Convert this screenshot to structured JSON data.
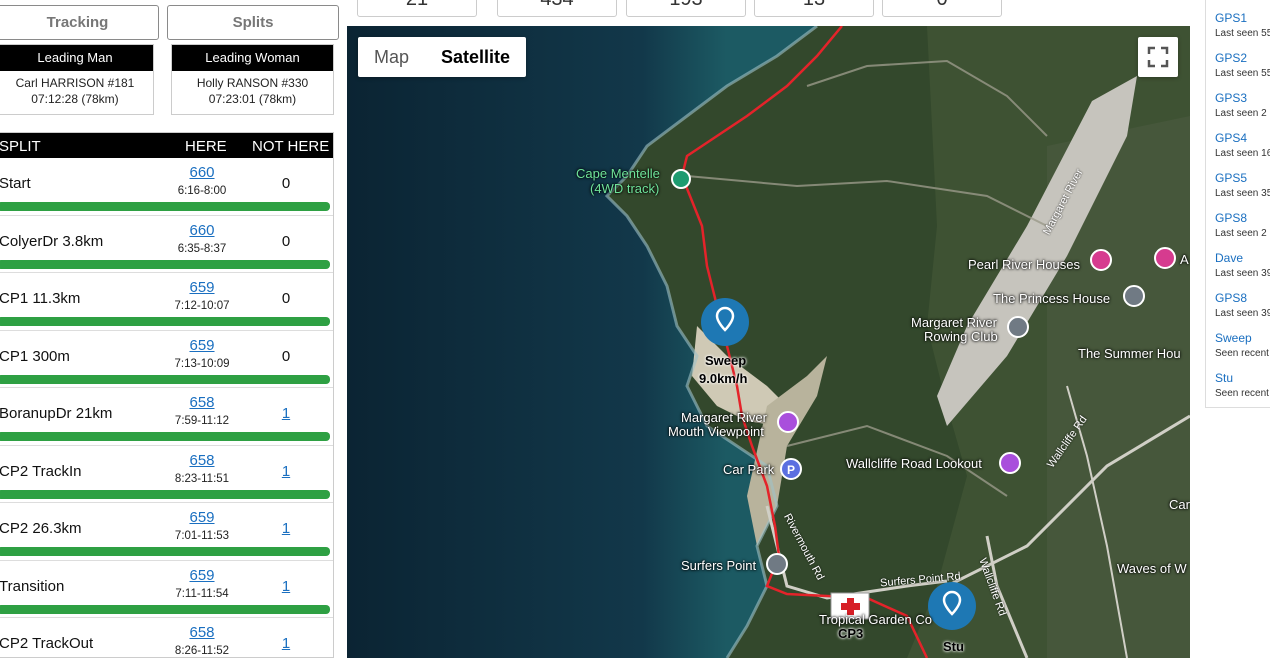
{
  "tabs": {
    "tracking": "Tracking",
    "splits": "Splits"
  },
  "leaders": {
    "man": {
      "title": "Leading Man",
      "name": "Carl HARRISON #181",
      "time": "07:12:28 (78km)"
    },
    "woman": {
      "title": "Leading Woman",
      "name": "Holly RANSON #330",
      "time": "07:23:01 (78km)"
    }
  },
  "stats": [
    "21",
    "434",
    "193",
    "13",
    "0"
  ],
  "splits": {
    "headers": {
      "split": "SPLIT",
      "here": "HERE",
      "not_here": "NOT HERE"
    },
    "rows": [
      {
        "name": "Start",
        "here": "660",
        "range": "6:16-8:00",
        "not_here": "0",
        "not_link": false
      },
      {
        "name": "ColyerDr 3.8km",
        "here": "660",
        "range": "6:35-8:37",
        "not_here": "0",
        "not_link": false
      },
      {
        "name": "CP1 11.3km",
        "here": "659",
        "range": "7:12-10:07",
        "not_here": "0",
        "not_link": false
      },
      {
        "name": "CP1 300m",
        "here": "659",
        "range": "7:13-10:09",
        "not_here": "0",
        "not_link": false
      },
      {
        "name": "BoranupDr 21km",
        "here": "658",
        "range": "7:59-11:12",
        "not_here": "1",
        "not_link": true
      },
      {
        "name": "CP2 TrackIn",
        "here": "658",
        "range": "8:23-11:51",
        "not_here": "1",
        "not_link": true
      },
      {
        "name": "CP2 26.3km",
        "here": "659",
        "range": "7:01-11:53",
        "not_here": "1",
        "not_link": true
      },
      {
        "name": "Transition",
        "here": "659",
        "range": "7:11-11:54",
        "not_here": "1",
        "not_link": true
      },
      {
        "name": "CP2 TrackOut",
        "here": "658",
        "range": "8:26-11:52",
        "not_here": "1",
        "not_link": true
      }
    ]
  },
  "map": {
    "map_label": "Map",
    "satellite_label": "Satellite",
    "labels": {
      "cape_mentelle": "Cape Mentelle",
      "cape_mentelle_sub": "(4WD track)",
      "sweep": "Sweep",
      "sweep_speed": "9.0km/h",
      "viewpoint1": "Margaret River",
      "viewpoint2": "Mouth Viewpoint",
      "car_park": "Car Park",
      "lookout": "Wallcliffe Road Lookout",
      "surfers_point": "Surfers Point",
      "garden": "Tropical Garden Co",
      "cp3": "CP3",
      "stu": "Stu",
      "pearl": "Pearl River Houses",
      "princess": "The Princess House",
      "rowing1": "Margaret River",
      "rowing2": "Rowing Club",
      "summer": "The Summer Hou",
      "waves": "Waves of W",
      "car_r": "Car",
      "a_r": "A",
      "margaret_river": "Margaret River",
      "rivermouth": "Rivermouth Rd",
      "surfers_rd": "Surfers Point Rd",
      "wallcliffe": "Wallcliffe Rd",
      "wallcliffe2": "Wallcliffe Rd"
    }
  },
  "devices": [
    {
      "name": "GPS1",
      "seen": "Last seen 55"
    },
    {
      "name": "GPS2",
      "seen": "Last seen 55"
    },
    {
      "name": "GPS3",
      "seen": "Last seen 2 l"
    },
    {
      "name": "GPS4",
      "seen": "Last seen 16"
    },
    {
      "name": "GPS5",
      "seen": "Last seen 35"
    },
    {
      "name": "GPS8",
      "seen": "Last seen 2 l"
    },
    {
      "name": "Dave",
      "seen": "Last seen 39"
    },
    {
      "name": "GPS8",
      "seen": "Last seen 39"
    },
    {
      "name": "Sweep",
      "seen": "Seen recent"
    },
    {
      "name": "Stu",
      "seen": "Seen recent"
    }
  ],
  "colors": {
    "route": "#e4232a",
    "bar": "#2ea043",
    "link": "#1a6fc0",
    "marker": "#1e78b4"
  }
}
